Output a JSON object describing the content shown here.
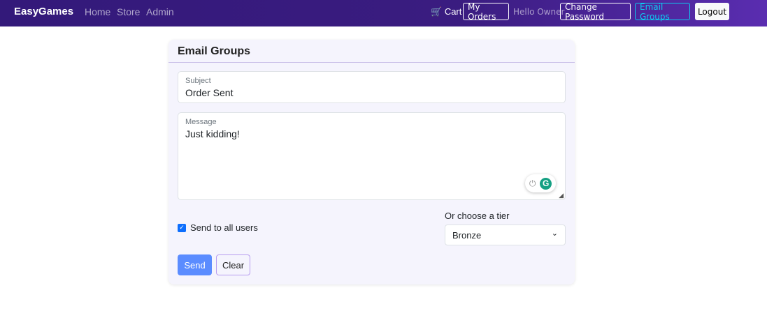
{
  "nav": {
    "brand": "EasyGames",
    "links": [
      "Home",
      "Store",
      "Admin"
    ],
    "cart": "Cart",
    "my_orders": "My Orders",
    "hello": "Hello Owner",
    "change_password": "Change Password",
    "email_groups": "Email Groups",
    "logout": "Logout"
  },
  "card": {
    "title": "Email Groups",
    "subject": {
      "label": "Subject",
      "value": "Order Sent"
    },
    "message": {
      "label": "Message",
      "value": "Just kidding!"
    },
    "send_all": {
      "label": "Send to all users",
      "checked": true
    },
    "tier": {
      "label": "Or choose a tier",
      "value": "Bronze"
    },
    "send": "Send",
    "clear": "Clear"
  },
  "colors": {
    "accent": "#5b8cff",
    "nav": "#35197b",
    "email_groups_border": "#0dcaf0"
  }
}
